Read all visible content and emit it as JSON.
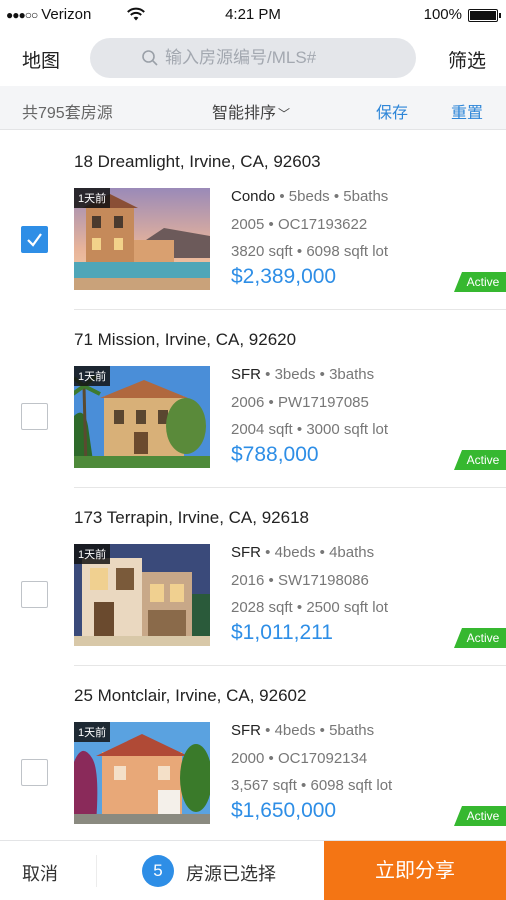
{
  "status_bar": {
    "carrier": "Verizon",
    "signal_dots": "●●●○○",
    "time": "4:21 PM",
    "battery": "100%"
  },
  "nav": {
    "map_label": "地图",
    "search_placeholder": "输入房源编号/MLS#",
    "filter_label": "筛选"
  },
  "sub_bar": {
    "count_label": "共795套房源",
    "sort_label": "智能排序",
    "save_label": "保存",
    "reset_label": "重置"
  },
  "listings": [
    {
      "address": "18 Dreamlight, Irvine, CA, 92603",
      "age": "1天前",
      "type": "Condo",
      "beds": "5beds",
      "baths": "5baths",
      "year": "2005",
      "mls": "OC17193622",
      "sqft": "3820 sqft",
      "lot": "6098 sqft lot",
      "price": "$2,389,000",
      "status": "Active",
      "checked": true
    },
    {
      "address": "71 Mission, Irvine, CA, 92620",
      "age": "1天前",
      "type": "SFR",
      "beds": "3beds",
      "baths": "3baths",
      "year": "2006",
      "mls": "PW17197085",
      "sqft": "2004 sqft",
      "lot": "3000 sqft lot",
      "price": "$788,000",
      "status": "Active",
      "checked": false
    },
    {
      "address": "173 Terrapin, Irvine, CA, 92618",
      "age": "1天前",
      "type": "SFR",
      "beds": "4beds",
      "baths": "4baths",
      "year": "2016",
      "mls": "SW17198086",
      "sqft": "2028 sqft",
      "lot": "2500 sqft lot",
      "price": "$1,011,211",
      "status": "Active",
      "checked": false
    },
    {
      "address": "25 Montclair, Irvine, CA, 92602",
      "age": "1天前",
      "type": "SFR",
      "beds": "4beds",
      "baths": "5baths",
      "year": "2000",
      "mls": "OC17092134",
      "sqft": "3,567 sqft",
      "lot": "6098 sqft lot",
      "price": "$1,650,000",
      "status": "Active",
      "checked": false
    }
  ],
  "bottom_bar": {
    "cancel_label": "取消",
    "selected_count": "5",
    "selected_label": "房源已选择",
    "share_label": "立即分享"
  },
  "colors": {
    "accent_blue": "#2e8ee6",
    "active_green": "#36b830",
    "share_orange": "#f47514"
  },
  "icons": {
    "search": "search-icon",
    "wifi": "wifi-icon",
    "battery": "battery-icon",
    "check": "checkmark-icon",
    "sort_chevron": "chevron-down-icon"
  }
}
